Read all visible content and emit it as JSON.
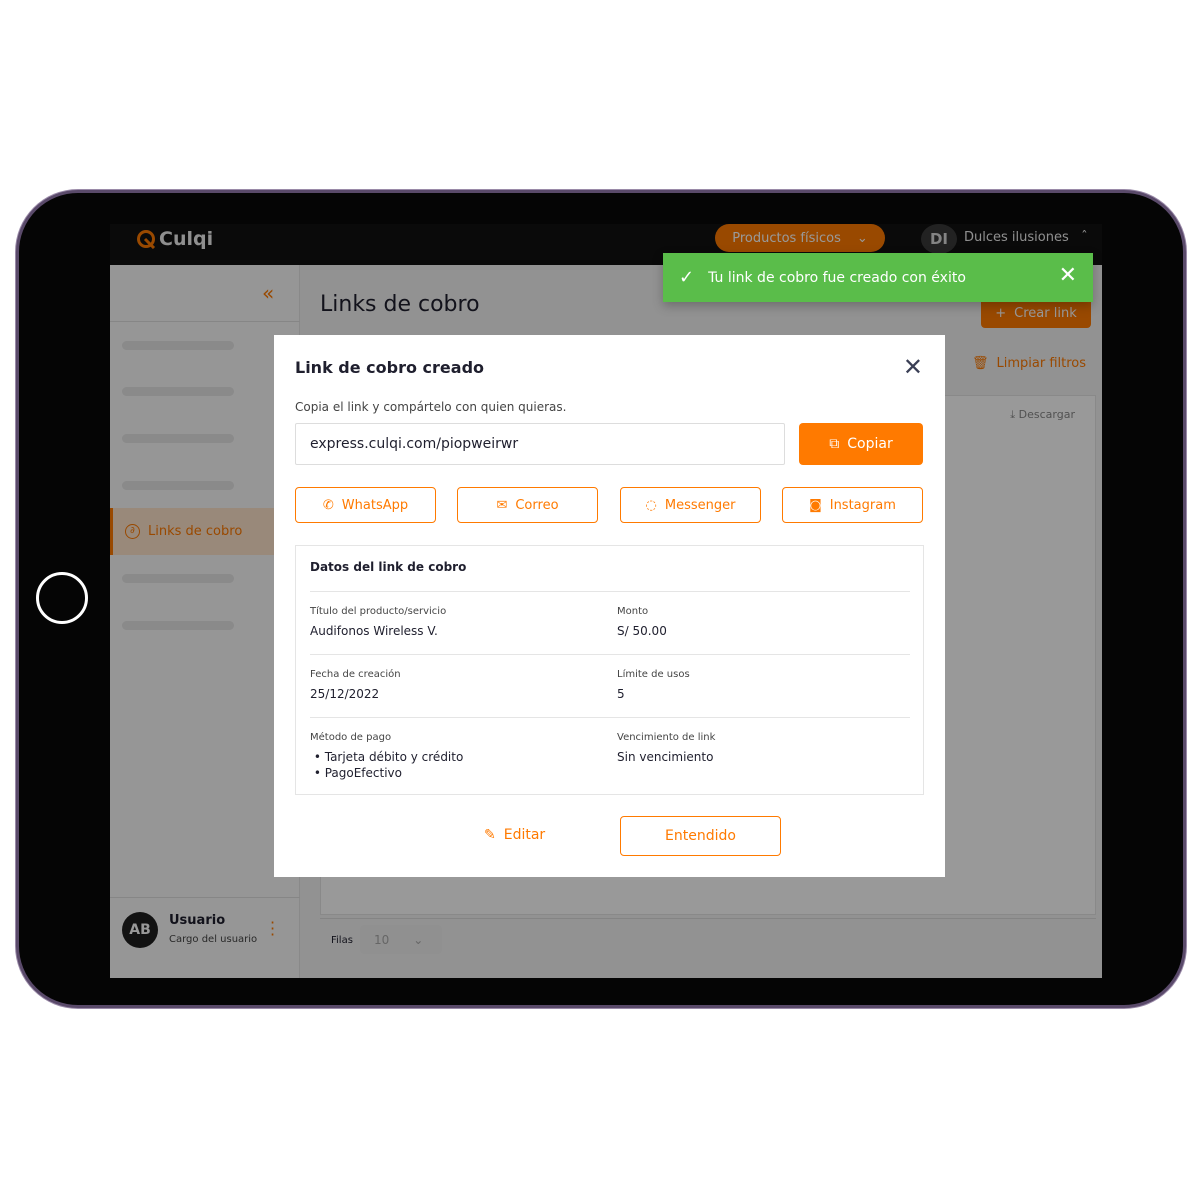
{
  "header": {
    "brand": "Culqi",
    "product_selector": "Productos físicos",
    "store_initials": "DI",
    "store_name": "Dulces ilusiones"
  },
  "sidebar": {
    "active_item": "Links de cobro",
    "user": {
      "initials": "AB",
      "name": "Usuario",
      "role": "Cargo del usuario"
    }
  },
  "main": {
    "title": "Links de cobro",
    "create_button": "Crear link",
    "clear_filters": "Limpiar filtros",
    "download": "Descargar",
    "rows_label": "Filas",
    "rows_value": "10"
  },
  "toast": {
    "message": "Tu link de cobro fue creado con éxito",
    "color": "#5abd4a"
  },
  "modal": {
    "title": "Link de cobro creado",
    "subtitle": "Copia el link y compártelo con quien quieras.",
    "link": "express.culqi.com/piopweirwr",
    "copy_button": "Copiar",
    "share": [
      "WhatsApp",
      "Correo",
      "Messenger",
      "Instagram"
    ],
    "details": {
      "title": "Datos del link de cobro",
      "product_label": "Título del producto/servicio",
      "product_value": "Audifonos Wireless V.",
      "amount_label": "Monto",
      "amount_value": "S/ 50.00",
      "date_label": "Fecha de creación",
      "date_value": "25/12/2022",
      "limit_label": "Límite de usos",
      "limit_value": "5",
      "method_label": "Método de pago",
      "methods": [
        "Tarjeta débito y crédito",
        "PagoEfectivo"
      ],
      "expiry_label": "Vencimiento de link",
      "expiry_value": "Sin vencimiento"
    },
    "edit_button": "Editar",
    "ok_button": "Entendido"
  },
  "accent": "#ff7a00"
}
